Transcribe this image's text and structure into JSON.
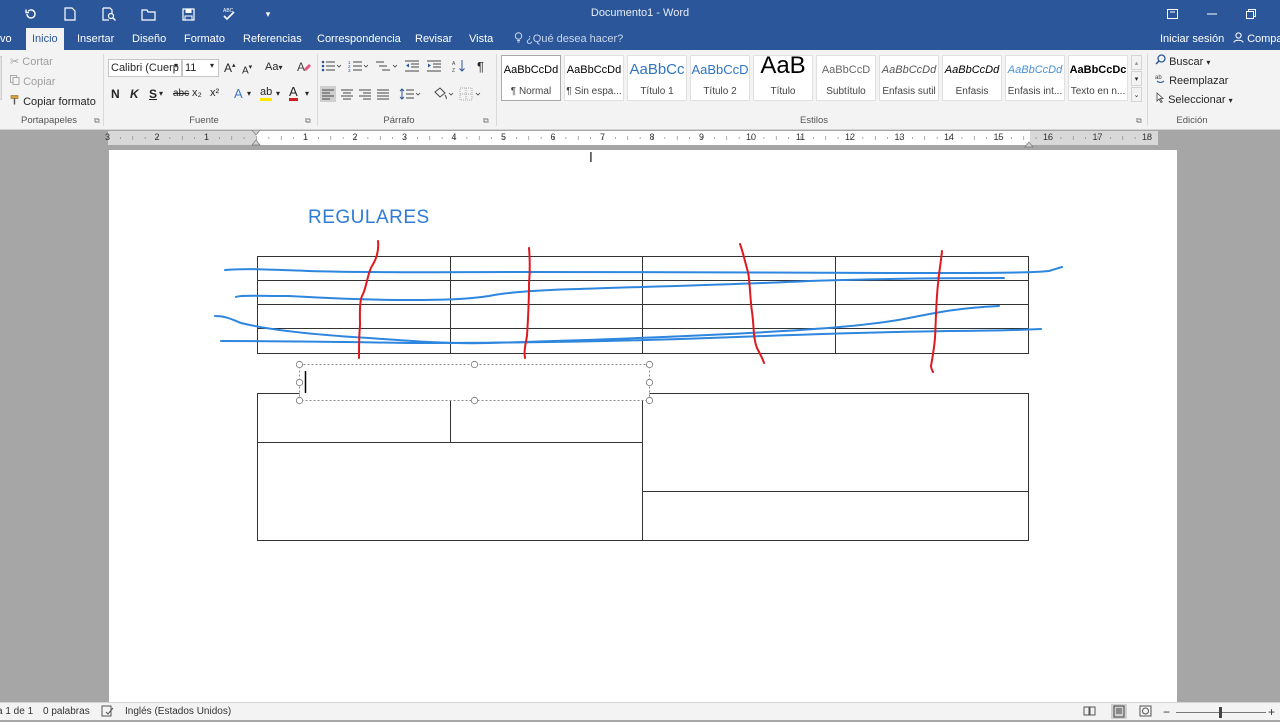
{
  "window": {
    "title": "Documento1 - Word"
  },
  "tabs": {
    "file": "vo",
    "home": "Inicio",
    "insert": "Insertar",
    "design": "Diseño",
    "format": "Formato",
    "references": "Referencias",
    "mailings": "Correspondencia",
    "review": "Revisar",
    "view": "Vista",
    "tell_me": "¿Qué desea hacer?",
    "sign_in": "Iniciar sesión",
    "share": "Compa"
  },
  "clipboard": {
    "cut": "Cortar",
    "copy": "Copiar",
    "format_painter": "Copiar formato",
    "label": "Portapapeles"
  },
  "font": {
    "name": "Calibri (Cuerp",
    "size": "11",
    "grow": "A",
    "shrink": "A",
    "case": "Aa",
    "bold": "N",
    "italic": "K",
    "underline": "S",
    "strike": "abc",
    "sub": "x₂",
    "sup": "x²",
    "effects": "A",
    "highlight": "ab",
    "color": "A",
    "label": "Fuente"
  },
  "paragraph": {
    "label": "Párrafo",
    "pilcrow": "¶"
  },
  "styles": {
    "label": "Estilos",
    "items": [
      {
        "sample": "AaBbCcDd",
        "name": "¶ Normal"
      },
      {
        "sample": "AaBbCcDd",
        "name": "¶ Sin espa..."
      },
      {
        "sample": "AaBbCc",
        "name": "Título 1"
      },
      {
        "sample": "AaBbCcD",
        "name": "Título 2"
      },
      {
        "sample": "AaB",
        "name": "Título"
      },
      {
        "sample": "AaBbCcD",
        "name": "Subtítulo"
      },
      {
        "sample": "AaBbCcDd",
        "name": "Énfasis sutil"
      },
      {
        "sample": "AaBbCcDd",
        "name": "Énfasis"
      },
      {
        "sample": "AaBbCcDd",
        "name": "Énfasis int..."
      },
      {
        "sample": "AaBbCcDc",
        "name": "Texto en n..."
      }
    ]
  },
  "editing": {
    "find": "Buscar",
    "replace": "Reemplazar",
    "select": "Seleccionar",
    "label": "Edición"
  },
  "ruler": {
    "left_numbers": [
      "3",
      "2",
      "1"
    ],
    "right_numbers": [
      "1",
      "2",
      "3",
      "4",
      "5",
      "6",
      "7",
      "8",
      "9",
      "10",
      "11",
      "12",
      "13",
      "14",
      "15",
      "16",
      "17",
      "18"
    ]
  },
  "document": {
    "heading": "REGULARES"
  },
  "status": {
    "page": "a 1 de 1",
    "words": "0 palabras",
    "language": "Inglés (Estados Unidos)"
  },
  "colors": {
    "word_blue": "#2b579a",
    "heading_blue": "#2f7bd6",
    "ink_blue": "#2e86de",
    "ink_red": "#e0191f"
  }
}
